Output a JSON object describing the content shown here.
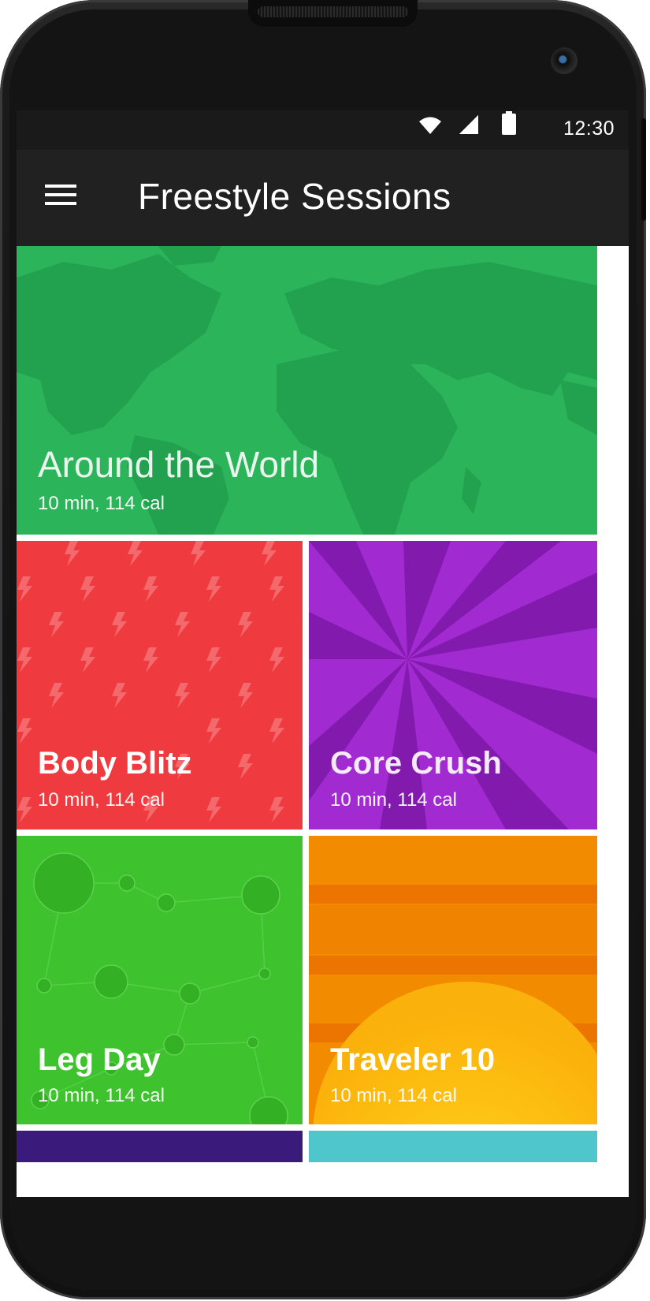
{
  "status_bar": {
    "time": "12:30",
    "icons": [
      "wifi-icon",
      "cell-signal-icon",
      "battery-icon"
    ]
  },
  "app_bar": {
    "title": "Freestyle Sessions",
    "menu_icon": "hamburger-menu-icon"
  },
  "sessions": [
    {
      "title": "Around the World",
      "subtitle": "10 min, 114 cal",
      "color": "#2cb45a",
      "pattern": "world-map"
    },
    {
      "title": "Body Blitz",
      "subtitle": "10 min, 114 cal",
      "color": "#ef3b3f",
      "pattern": "lightning-bolts"
    },
    {
      "title": "Core Crush",
      "subtitle": "10 min, 114 cal",
      "color": "#9b21c8",
      "pattern": "sunburst"
    },
    {
      "title": "Leg Day",
      "subtitle": "10 min, 114 cal",
      "color": "#3ec32e",
      "pattern": "constellation"
    },
    {
      "title": "Traveler 10",
      "subtitle": "10 min, 114 cal",
      "color": "#f28b00",
      "pattern": "sunset-stripes"
    },
    {
      "title": "",
      "subtitle": "",
      "color": "#3a1a7a",
      "pattern": "partial"
    },
    {
      "title": "",
      "subtitle": "",
      "color": "#4fc6cc",
      "pattern": "partial"
    }
  ]
}
